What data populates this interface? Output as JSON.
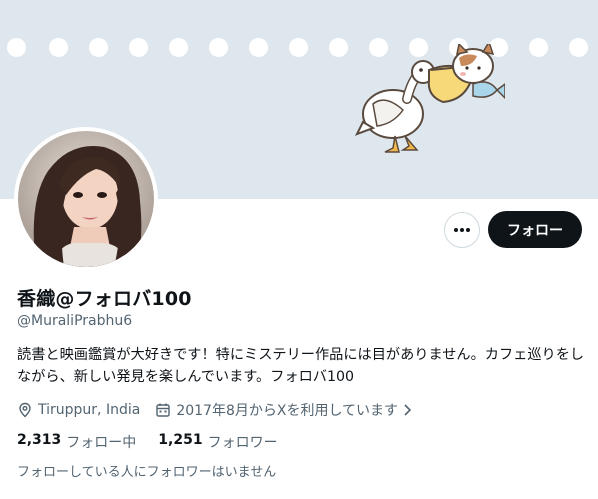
{
  "profile": {
    "display_name": "香織@フォロバ100",
    "handle": "@MuraliPrabhu6",
    "bio": "読書と映画鑑賞が大好きです！特にミステリー作品には目がありません。カフェ巡りをしながら、新しい発見を楽しんでいます。フォロバ100",
    "location": "Tiruppur, India",
    "joined": "2017年8月からXを利用しています"
  },
  "actions": {
    "more_label": "•••",
    "follow_label": "フォロー"
  },
  "stats": {
    "following_count": "2,313",
    "following_label": "フォロー中",
    "followers_count": "1,251",
    "followers_label": "フォロワー"
  },
  "footnote": "フォローしている人にフォロワーはいません",
  "colors": {
    "banner": "#dfe7ee",
    "text": "#0f1419",
    "secondary": "#536471",
    "button": "#0f1419"
  },
  "icons": {
    "location": "location-pin-icon",
    "calendar": "calendar-icon",
    "chevron": "chevron-right-icon"
  }
}
